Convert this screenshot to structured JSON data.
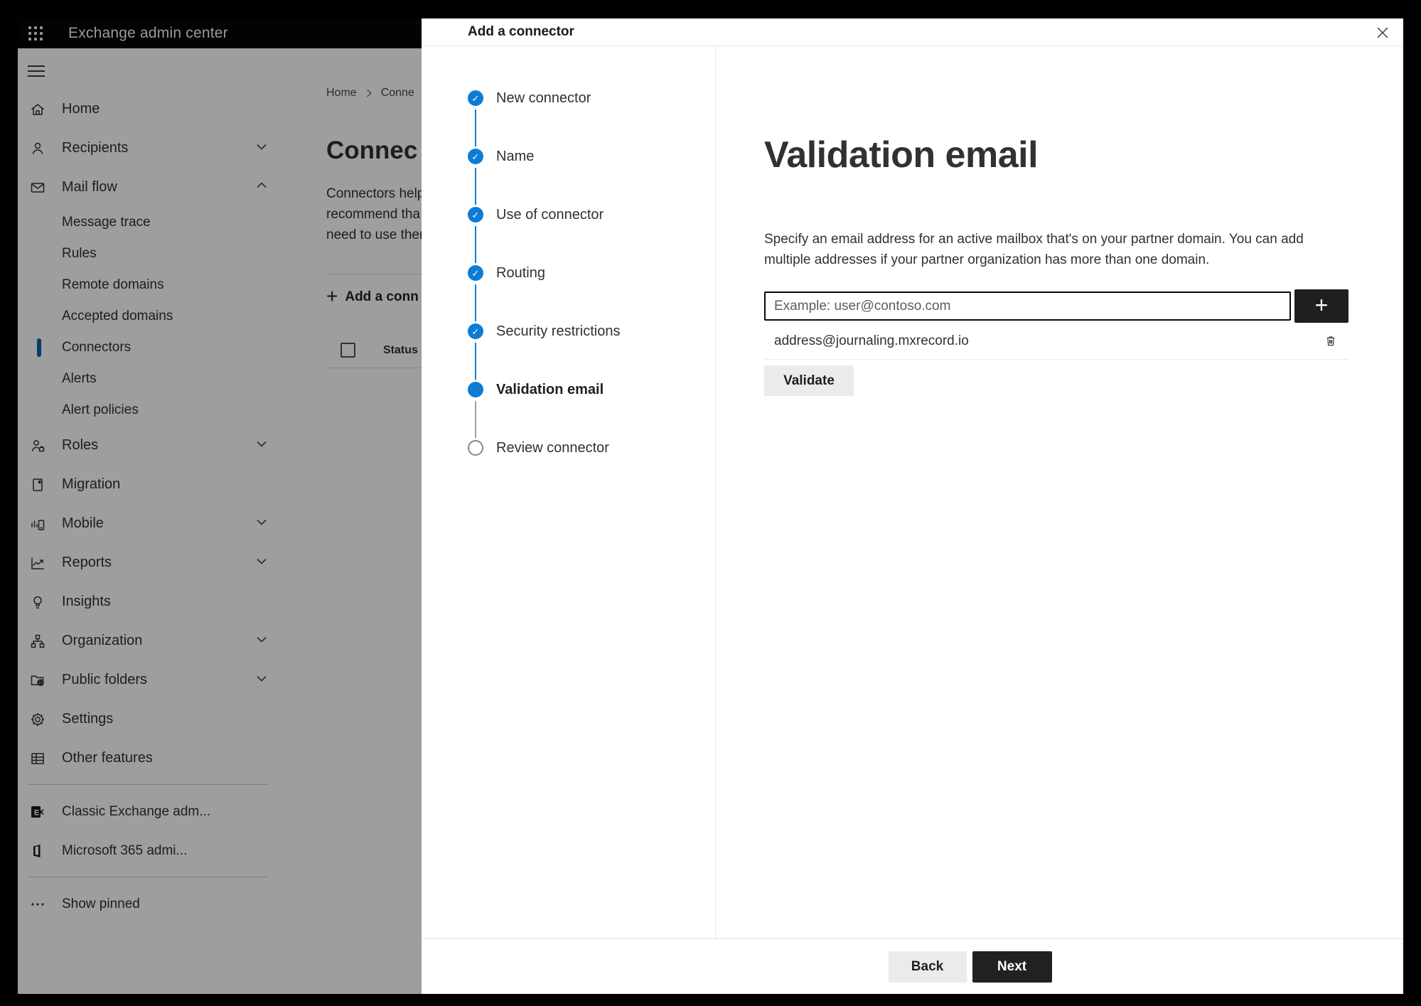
{
  "topbar": {
    "app_launcher_icon": "waffle-icon",
    "title": "Exchange admin center"
  },
  "sidebar": {
    "hamburger_icon": "hamburger-icon",
    "top_items": [
      {
        "label": "Home",
        "icon": "home-icon",
        "chevron": null
      },
      {
        "label": "Recipients",
        "icon": "person-icon",
        "chevron": "down"
      },
      {
        "label": "Mail flow",
        "icon": "mail-icon",
        "chevron": "up"
      }
    ],
    "mail_flow_children": [
      "Message trace",
      "Rules",
      "Remote domains",
      "Accepted domains",
      "Connectors",
      "Alerts",
      "Alert policies"
    ],
    "selected_item": "Connectors",
    "bottom_items": [
      {
        "label": "Roles",
        "icon": "roles-icon",
        "chevron": "down"
      },
      {
        "label": "Migration",
        "icon": "migration-icon",
        "chevron": null
      },
      {
        "label": "Mobile",
        "icon": "mobile-icon",
        "chevron": "down"
      },
      {
        "label": "Reports",
        "icon": "reports-icon",
        "chevron": "down"
      },
      {
        "label": "Insights",
        "icon": "insights-icon",
        "chevron": null
      },
      {
        "label": "Organization",
        "icon": "organization-icon",
        "chevron": "down"
      },
      {
        "label": "Public folders",
        "icon": "public-folders-icon",
        "chevron": "down"
      },
      {
        "label": "Settings",
        "icon": "settings-icon",
        "chevron": null
      },
      {
        "label": "Other features",
        "icon": "other-features-icon",
        "chevron": null
      }
    ],
    "footer_items": [
      {
        "label": "Classic Exchange adm...",
        "icon": "classic-exchange-icon"
      },
      {
        "label": "Microsoft 365 admi...",
        "icon": "microsoft-365-icon"
      }
    ],
    "show_pinned": {
      "label": "Show pinned",
      "icon": "ellipsis-icon"
    }
  },
  "page": {
    "breadcrumb": [
      "Home",
      "Conne"
    ],
    "heading_fragment": "Connec",
    "description_fragments": [
      "Connectors help",
      "recommend tha",
      "need to use ther"
    ],
    "add_button_fragment": "Add a conn",
    "table": {
      "status_header": "Status"
    }
  },
  "dialog": {
    "title": "Add a connector",
    "close_icon": "close-icon",
    "steps": [
      {
        "label": "New connector",
        "state": "completed"
      },
      {
        "label": "Name",
        "state": "completed"
      },
      {
        "label": "Use of connector",
        "state": "completed"
      },
      {
        "label": "Routing",
        "state": "completed"
      },
      {
        "label": "Security restrictions",
        "state": "completed"
      },
      {
        "label": "Validation email",
        "state": "current"
      },
      {
        "label": "Review connector",
        "state": "upcoming"
      }
    ],
    "content": {
      "heading": "Validation email",
      "description": "Specify an email address for an active mailbox that's on your partner domain. You can add multiple addresses if your partner organization has more than one domain.",
      "email_placeholder": "Example: user@contoso.com",
      "add_address_icon": "plus-icon",
      "added_addresses": [
        {
          "address": "address@journaling.mxrecord.io",
          "delete_icon": "trash-icon"
        }
      ],
      "validate_button": "Validate"
    },
    "footer": {
      "back_button": "Back",
      "next_button": "Next"
    }
  },
  "colors": {
    "accent_blue": "#0d7cd5",
    "dark_button": "#201f1e",
    "neutral_button": "#edebe9",
    "topbar_background": "#060606"
  }
}
